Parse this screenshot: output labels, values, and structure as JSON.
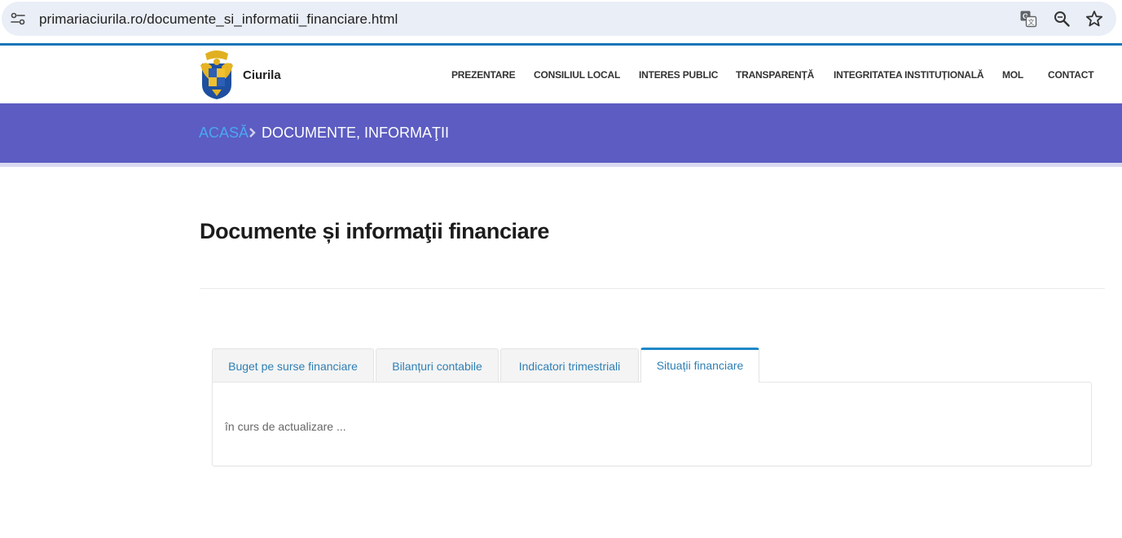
{
  "browser": {
    "url": "primariaciurila.ro/documente_si_informatii_financiare.html",
    "icons": [
      "site-info-icon",
      "translate-icon",
      "zoom-icon",
      "bookmark-star-icon"
    ]
  },
  "header": {
    "site_name": "Ciurila",
    "nav": [
      "PREZENTARE",
      "CONSILIUL LOCAL",
      "INTERES PUBLIC",
      "TRANSPARENȚĂ",
      "INTEGRITATEA INSTITUȚIONALĂ",
      "MOL",
      "CONTACT"
    ]
  },
  "breadcrumb": {
    "home": "ACASĂ",
    "current": "DOCUMENTE, INFORMAŢII"
  },
  "page": {
    "title": "Documente și informaţii financiare"
  },
  "tabs": {
    "items": [
      "Buget pe surse financiare",
      "Bilanțuri contabile",
      "Indicatori trimestriali",
      "Situații financiare"
    ],
    "active_index": 3,
    "panel_text": "în curs de actualizare ..."
  },
  "colors": {
    "breadcrumb_band": "#5c5cc2",
    "breadcrumb_home": "#4aa8f0",
    "tab_link": "#2e7fb4",
    "active_tab_border": "#1e88c8",
    "accent_line": "#1976b8"
  }
}
